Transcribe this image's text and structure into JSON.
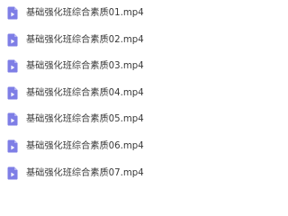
{
  "file_list": {
    "icon": "video-file-icon",
    "icon_color": "#7e7ee6",
    "items": [
      {
        "name": "基础强化班综合素质01.mp4"
      },
      {
        "name": "基础强化班综合素质02.mp4"
      },
      {
        "name": "基础强化班综合素质03.mp4"
      },
      {
        "name": "基础强化班综合素质04.mp4"
      },
      {
        "name": "基础强化班综合素质05.mp4"
      },
      {
        "name": "基础强化班综合素质06.mp4"
      },
      {
        "name": "基础强化班综合素质07.mp4"
      }
    ]
  }
}
